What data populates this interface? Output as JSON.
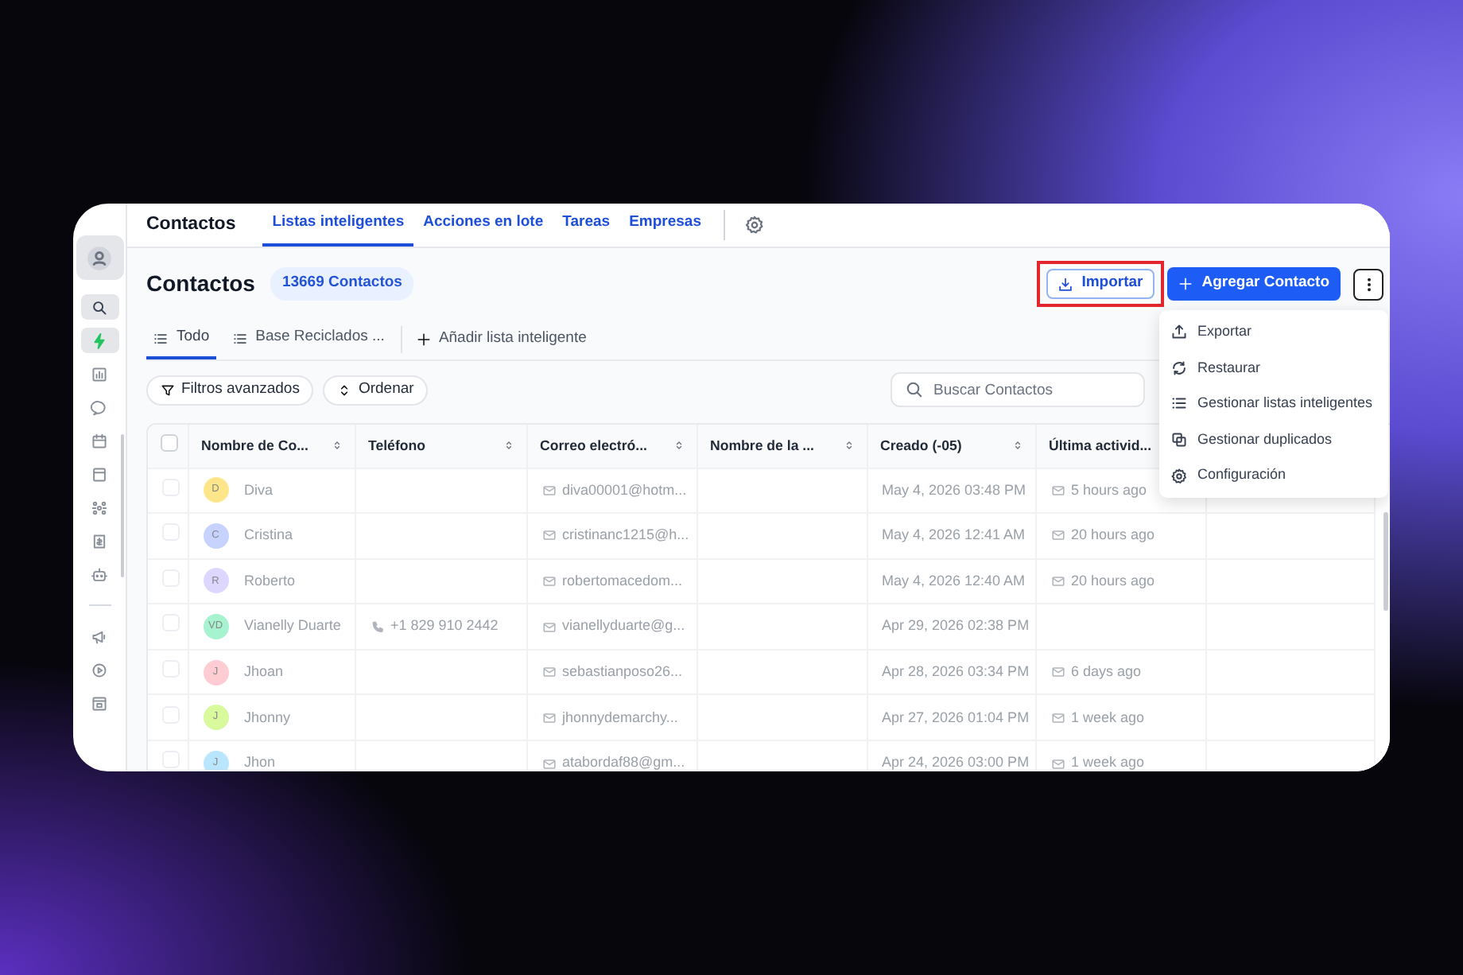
{
  "sidebar": {
    "items": [
      {
        "kind": "avatar",
        "selected": true
      },
      {
        "kind": "search",
        "selected": true
      },
      {
        "kind": "bolt",
        "selected": true
      },
      {
        "kind": "chart",
        "selected": false
      },
      {
        "kind": "chat",
        "selected": false
      },
      {
        "kind": "calendar",
        "selected": false
      },
      {
        "kind": "notebook",
        "selected": false
      },
      {
        "kind": "nodes",
        "selected": false
      },
      {
        "kind": "invoice",
        "selected": false
      },
      {
        "kind": "robot",
        "selected": false
      },
      {
        "kind": "divider"
      },
      {
        "kind": "megaphone",
        "selected": false
      },
      {
        "kind": "play",
        "selected": false
      },
      {
        "kind": "window",
        "selected": false
      }
    ]
  },
  "top_nav": {
    "title": "Contactos",
    "tabs": [
      {
        "label": "Listas inteligentes",
        "selected": true
      },
      {
        "label": "Acciones en lote",
        "selected": false
      },
      {
        "label": "Tareas",
        "selected": false
      },
      {
        "label": "Empresas",
        "selected": false
      }
    ]
  },
  "header": {
    "title": "Contactos",
    "count_badge": "13669 Contactos",
    "buttons": [
      {
        "kind": "import",
        "label": "Importar",
        "highlighted": true
      },
      {
        "kind": "add",
        "label": "Agregar Contacto",
        "highlighted": false
      }
    ],
    "more_menu": {
      "expanded": true,
      "items": [
        {
          "kind": "export",
          "label": "Exportar"
        },
        {
          "kind": "restore",
          "label": "Restaurar"
        },
        {
          "kind": "list",
          "label": "Gestionar listas inteligentes"
        },
        {
          "kind": "duplicate",
          "label": "Gestionar duplicados"
        },
        {
          "kind": "settings",
          "label": "Configuración"
        }
      ]
    }
  },
  "list_tabs": [
    {
      "label": "Todo",
      "selected": true
    },
    {
      "label": "Base Reciclados ...",
      "selected": false
    }
  ],
  "add_list": "Añadir lista inteligente",
  "filters": [
    "Filtros avanzados",
    "Ordenar"
  ],
  "search": {
    "placeholder": "Buscar Contactos"
  },
  "table": {
    "all_selected": false,
    "columns": [
      {
        "label": "Nombre de Co...",
        "sortable": true
      },
      {
        "label": "Teléfono",
        "sortable": true
      },
      {
        "label": "Correo electró...",
        "sortable": true
      },
      {
        "label": "Nombre de la ...",
        "sortable": true
      },
      {
        "label": "Creado (-05)",
        "sortable": true
      },
      {
        "label": "Última activid...",
        "sortable": false
      }
    ],
    "rows": [
      {
        "checked": false,
        "initials": "D",
        "color": "#fde68a",
        "name": "Diva",
        "phone": "",
        "email": "diva00001@hotm...",
        "company": "",
        "created": "May 4, 2026 03:48 PM",
        "activity": "5 hours ago"
      },
      {
        "checked": false,
        "initials": "C",
        "color": "#c7d2fe",
        "name": "Cristina",
        "phone": "",
        "email": "cristinanc1215@h...",
        "company": "",
        "created": "May 4, 2026 12:41 AM",
        "activity": "20 hours ago"
      },
      {
        "checked": false,
        "initials": "R",
        "color": "#ddd6fe",
        "name": "Roberto",
        "phone": "",
        "email": "robertomacedom...",
        "company": "",
        "created": "May 4, 2026 12:40 AM",
        "activity": "20 hours ago"
      },
      {
        "checked": false,
        "initials": "VD",
        "color": "#a7f3d0",
        "name": "Vianelly Duarte",
        "phone": "+1 829 910 2442",
        "email": "vianellyduarte@g...",
        "company": "",
        "created": "Apr 29, 2026 02:38 PM",
        "activity": ""
      },
      {
        "checked": false,
        "initials": "J",
        "color": "#fecdd3",
        "name": "Jhoan",
        "phone": "",
        "email": "sebastianposo26...",
        "company": "",
        "created": "Apr 28, 2026 03:34 PM",
        "activity": "6 days ago"
      },
      {
        "checked": false,
        "initials": "J",
        "color": "#d9f99d",
        "name": "Jhonny",
        "phone": "",
        "email": "jhonnydemarchy...",
        "company": "",
        "created": "Apr 27, 2026 01:04 PM",
        "activity": "1 week ago"
      },
      {
        "checked": false,
        "initials": "J",
        "color": "#bae6fd",
        "name": "Jhon",
        "phone": "",
        "email": "atabordaf88@gm...",
        "company": "",
        "created": "Apr 24, 2026 03:00 PM",
        "activity": "1 week ago"
      }
    ]
  }
}
